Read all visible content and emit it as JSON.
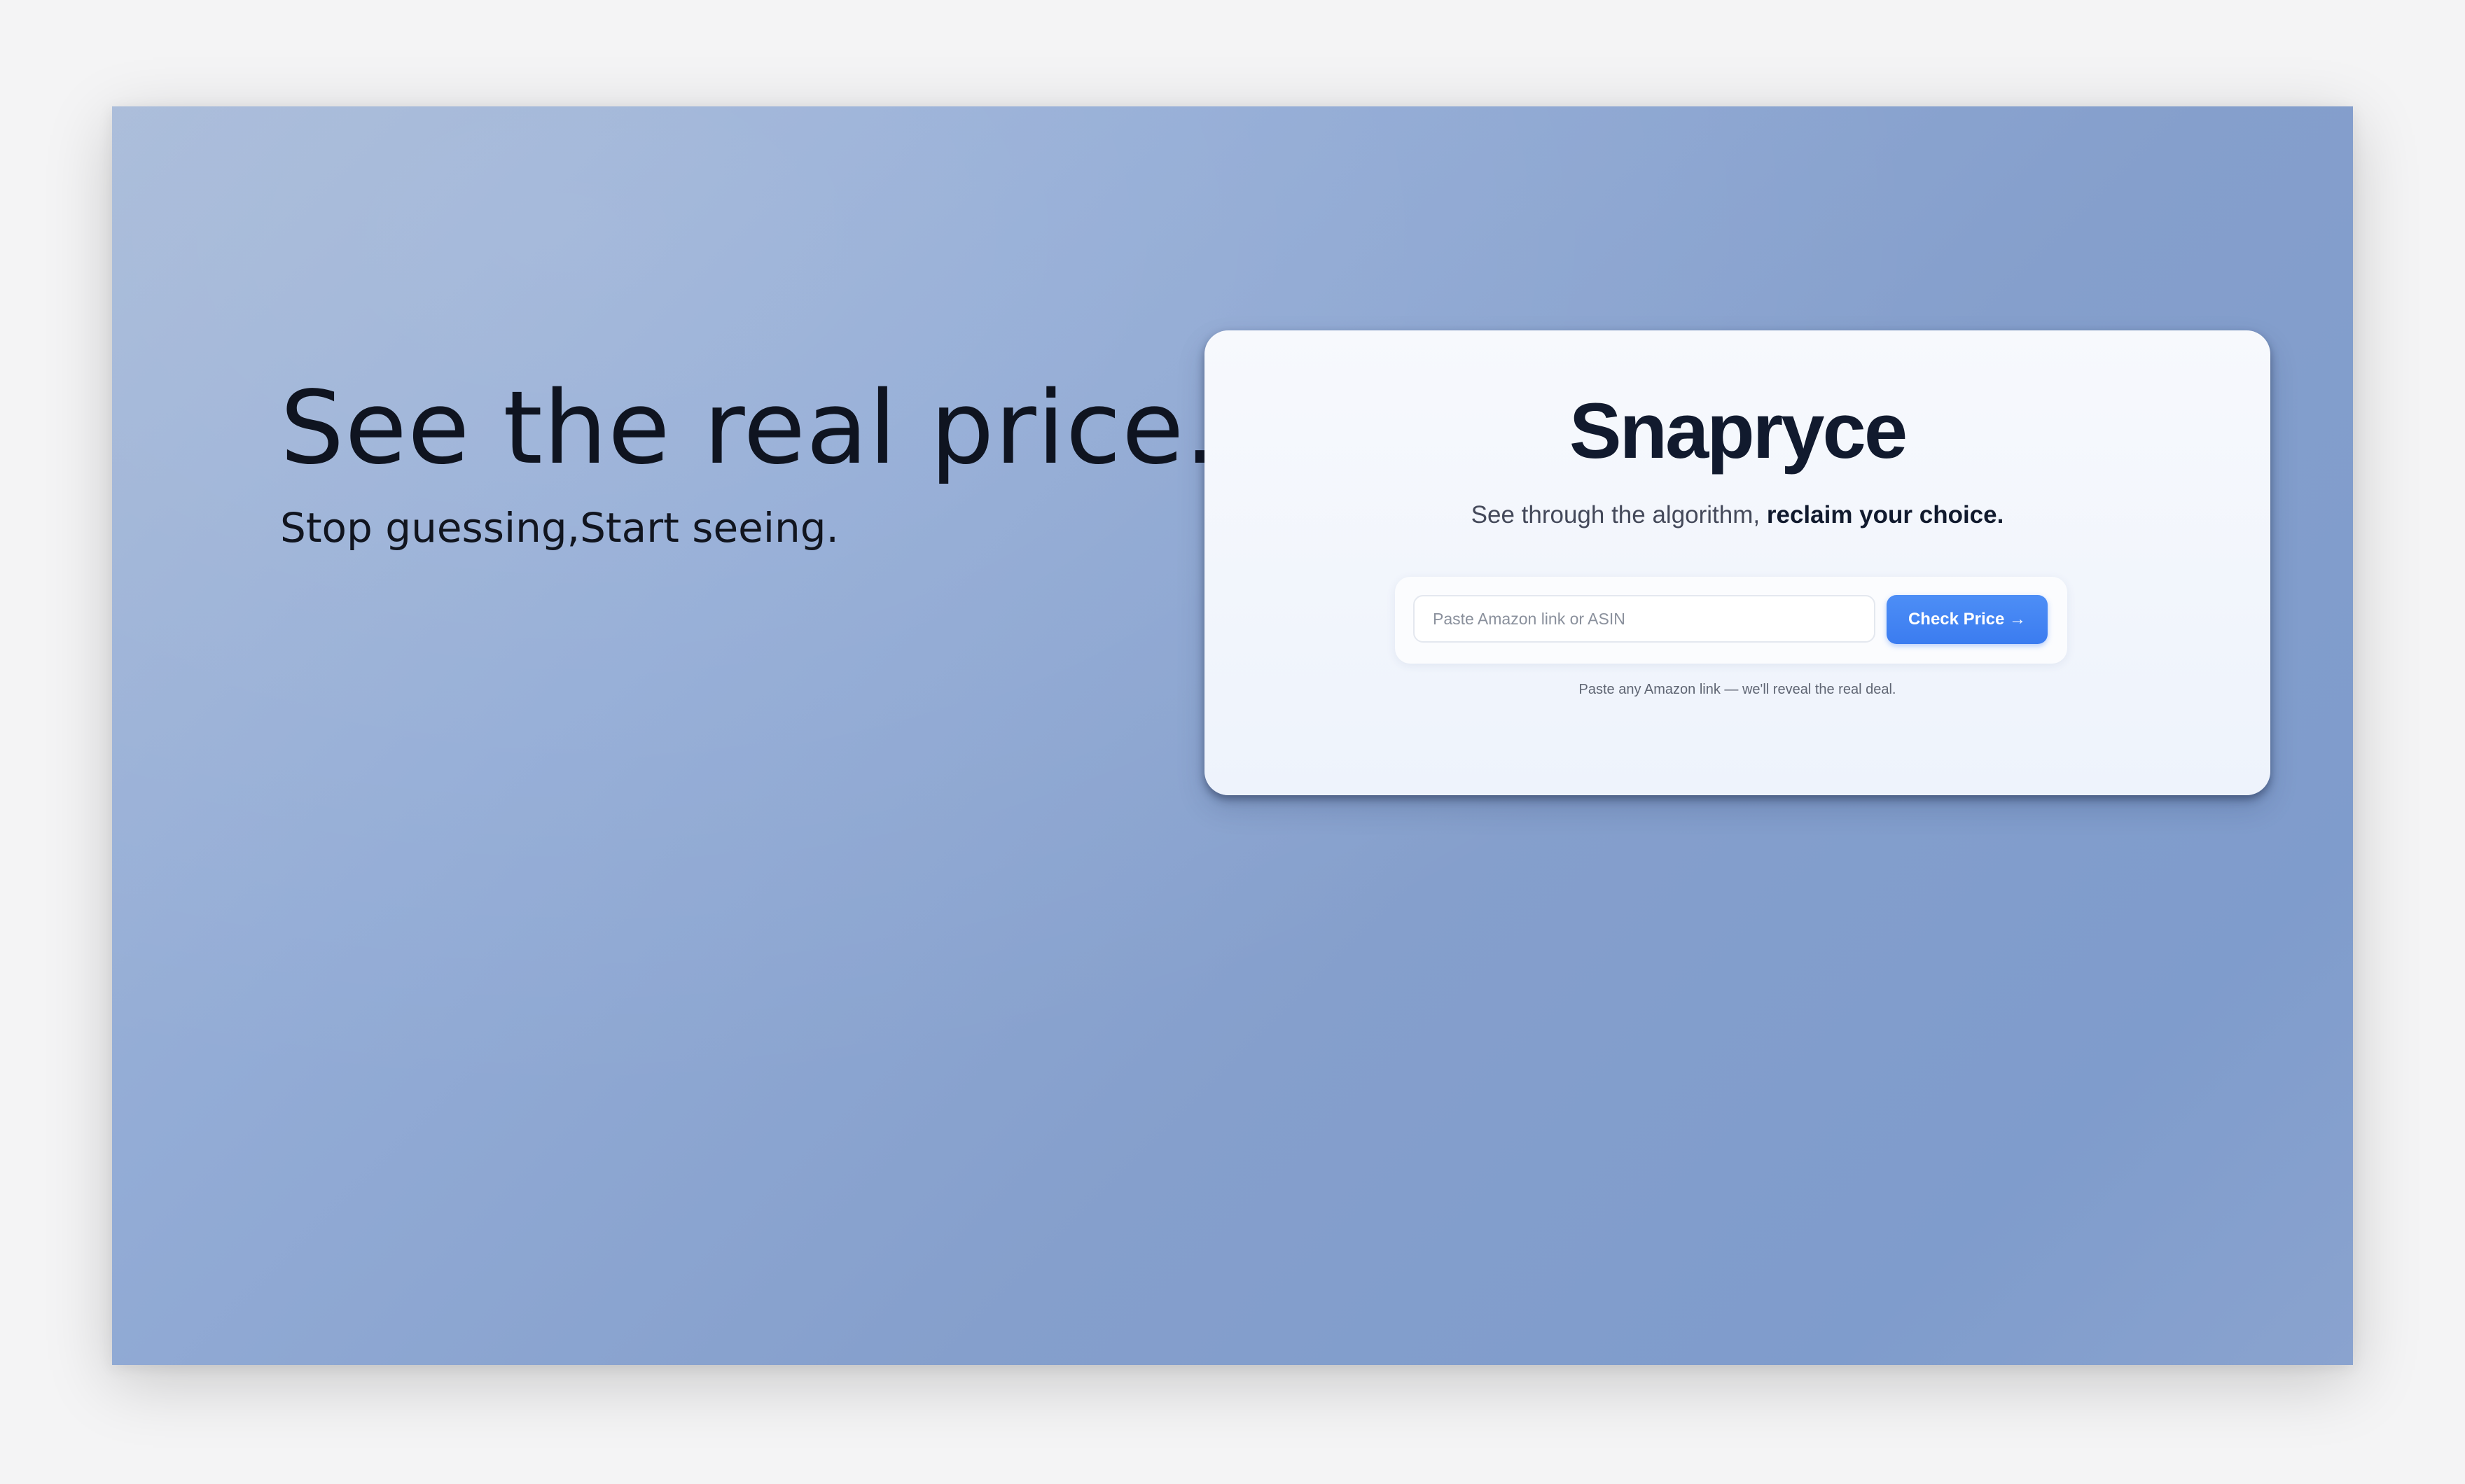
{
  "hero": {
    "title": "See the real price.",
    "subtitle": "Stop guessing,Start seeing."
  },
  "card": {
    "brand": "Snapryce",
    "tagline_regular": "See through the algorithm, ",
    "tagline_bold": "reclaim your choice.",
    "search": {
      "value": "",
      "placeholder": "Paste Amazon link or ASIN"
    },
    "button_label": "Check Price →",
    "helper_text": "Paste any Amazon link — we'll reveal the real deal."
  },
  "colors": {
    "accent": "#3b7cf0",
    "brand_text": "#111a2e",
    "background": "#8aa3cf"
  }
}
